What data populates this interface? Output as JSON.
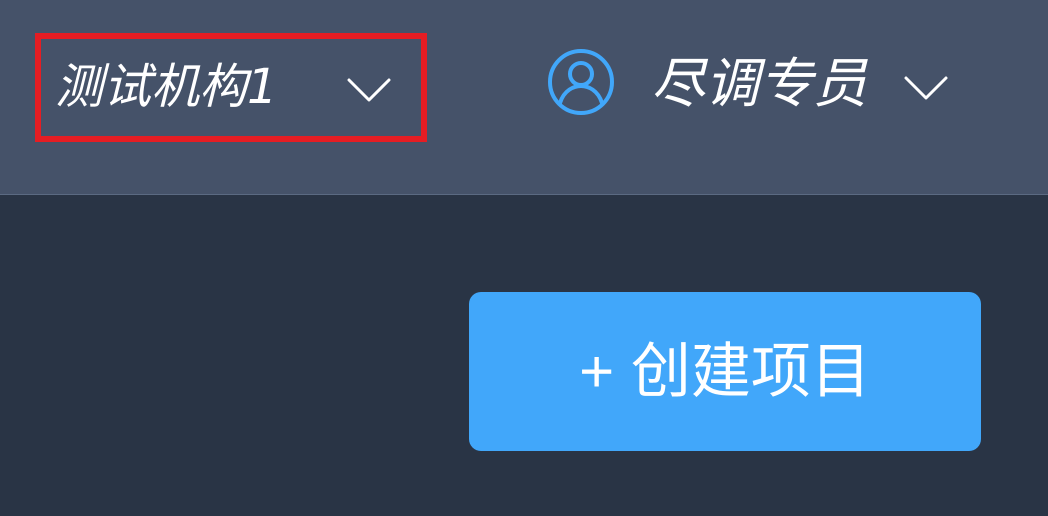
{
  "header": {
    "organization_label": "测试机构1",
    "user_role_label": "尽调专员"
  },
  "main": {
    "create_project_label": "+ 创建项目"
  },
  "icons": {
    "organization_dropdown": "chevron-down-icon",
    "user_avatar": "user-avatar-icon",
    "user_dropdown": "chevron-down-icon"
  },
  "colors": {
    "header_background": "#455269",
    "page_background": "#293445",
    "highlight_border": "#e51d23",
    "accent": "#41a7fa",
    "text": "#ffffff"
  }
}
